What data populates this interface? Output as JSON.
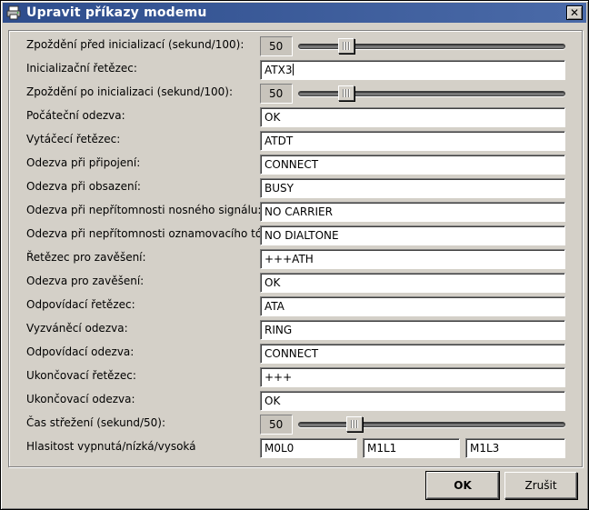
{
  "window": {
    "title": "Upravit příkazy modemu",
    "icon": "printer-icon",
    "close_glyph": "✕"
  },
  "rows": [
    {
      "label": "Zpoždění před inicializací (sekund/100):",
      "type": "slider",
      "value": "50",
      "fraction": 0.18
    },
    {
      "label": "Inicializační řetězec:",
      "type": "text",
      "value": "ATX3",
      "focused": true
    },
    {
      "label": "Zpoždění po inicializaci (sekund/100):",
      "type": "slider",
      "value": "50",
      "fraction": 0.18
    },
    {
      "label": "Počáteční odezva:",
      "type": "text",
      "value": "OK"
    },
    {
      "label": "Vytáčecí řetězec:",
      "type": "text",
      "value": "ATDT"
    },
    {
      "label": "Odezva při připojení:",
      "type": "text",
      "value": "CONNECT"
    },
    {
      "label": "Odezva při obsazení:",
      "type": "text",
      "value": "BUSY"
    },
    {
      "label": "Odezva při nepřítomnosti nosného signálu:",
      "type": "text",
      "value": "NO CARRIER"
    },
    {
      "label": "Odezva při nepřítomnosti oznamovacího tónu:",
      "type": "text",
      "value": "NO DIALTONE"
    },
    {
      "label": "Řetězec pro zavěšení:",
      "type": "text",
      "value": "+++ATH"
    },
    {
      "label": "Odezva pro zavěšení:",
      "type": "text",
      "value": "OK"
    },
    {
      "label": "Odpovídací řetězec:",
      "type": "text",
      "value": "ATA"
    },
    {
      "label": "Vyzváněcí odezva:",
      "type": "text",
      "value": "RING"
    },
    {
      "label": "Odpovídací odezva:",
      "type": "text",
      "value": "CONNECT"
    },
    {
      "label": "Ukončovací řetězec:",
      "type": "text",
      "value": "+++"
    },
    {
      "label": "Ukončovací odezva:",
      "type": "text",
      "value": "OK"
    },
    {
      "label": "Čas střežení (sekund/50):",
      "type": "slider",
      "value": "50",
      "fraction": 0.21
    },
    {
      "label": "Hlasitost vypnutá/nízká/vysoká",
      "type": "triple",
      "values": [
        "M0L0",
        "M1L1",
        "M1L3"
      ]
    }
  ],
  "buttons": {
    "ok": "OK",
    "cancel": "Zrušit"
  },
  "colors": {
    "titlebar": "#3b5998",
    "face": "#d4d0c8"
  }
}
